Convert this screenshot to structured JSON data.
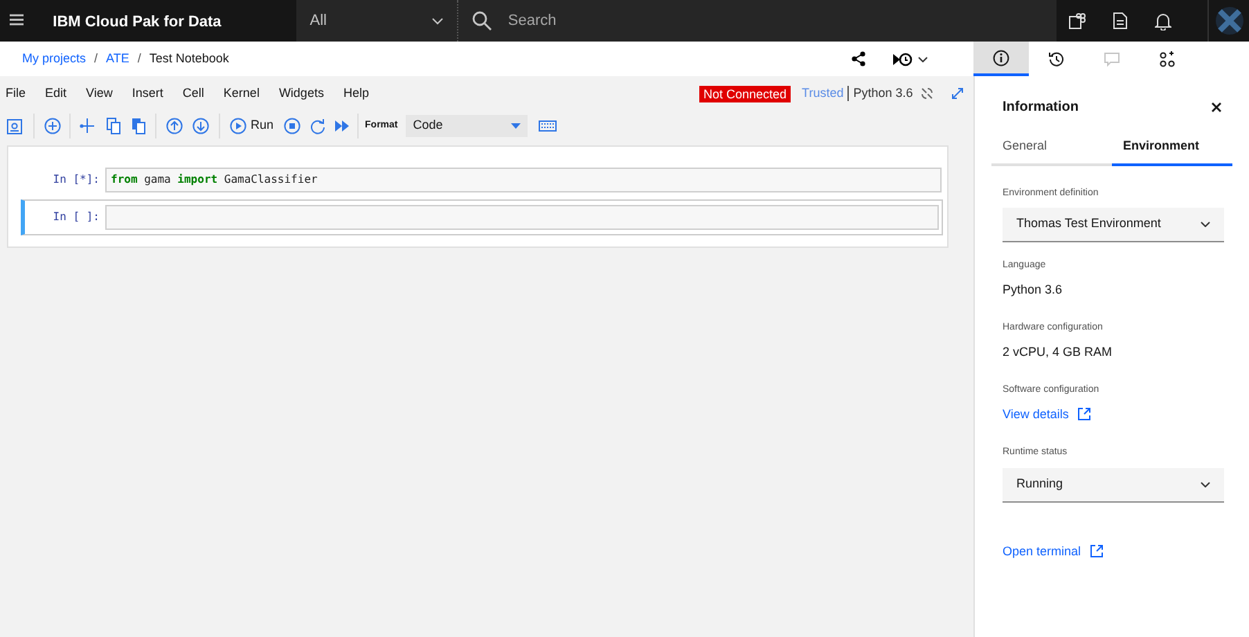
{
  "header": {
    "product": "IBM Cloud Pak for Data",
    "scope": "All",
    "search": {
      "placeholder": "Search"
    }
  },
  "breadcrumb": [
    {
      "text": "My projects",
      "kind": "link"
    },
    {
      "text": "/",
      "kind": "separator"
    },
    {
      "text": "ATE",
      "kind": "link"
    },
    {
      "text": "/",
      "kind": "separator"
    },
    {
      "text": "Test Notebook",
      "kind": "current"
    }
  ],
  "side_tabs": [
    {
      "selected": true
    },
    {
      "selected": false
    },
    {
      "selected": false,
      "disabled": true
    },
    {
      "selected": false
    }
  ],
  "notebook": {
    "menu": [
      "File",
      "Edit",
      "View",
      "Insert",
      "Cell",
      "Kernel",
      "Widgets",
      "Help"
    ],
    "status": "Not Connected",
    "trusted": "Trusted",
    "kernel": "Python 3.6",
    "toolbar": {
      "run": "Run",
      "format_label": "Format",
      "format": "Code"
    },
    "cells": [
      {
        "prompt": "In [*]:",
        "selected": false,
        "tokens": [
          {
            "text": "from",
            "kind": "keyword"
          },
          {
            "text": " gama ",
            "kind": "plain"
          },
          {
            "text": "import",
            "kind": "keyword"
          },
          {
            "text": " GamaClassifier",
            "kind": "plain"
          }
        ]
      },
      {
        "prompt": "In [ ]:",
        "selected": true
      }
    ]
  },
  "panel": {
    "title": "Information",
    "tabs": [
      {
        "label": "General",
        "selected": false
      },
      {
        "label": "Environment",
        "selected": true
      }
    ],
    "fields": [
      {
        "label": "Environment definition",
        "kind": "select",
        "value": "Thomas Test Environment"
      },
      {
        "label": "Language",
        "kind": "text",
        "value": "Python 3.6"
      },
      {
        "label": "Hardware configuration",
        "kind": "text",
        "value": "2 vCPU, 4 GB RAM"
      },
      {
        "label": "Software configuration",
        "kind": "link",
        "value": "View details"
      },
      {
        "label": "Runtime status",
        "kind": "select",
        "value": "Running"
      }
    ],
    "footer_link": "Open terminal"
  }
}
